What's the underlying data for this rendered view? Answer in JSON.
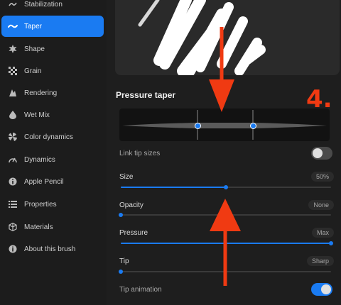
{
  "sidebar": {
    "items": [
      {
        "label": "Stabilization",
        "icon": "stabilization-icon",
        "active": false
      },
      {
        "label": "Taper",
        "icon": "taper-icon",
        "active": true
      },
      {
        "label": "Shape",
        "icon": "shape-icon",
        "active": false
      },
      {
        "label": "Grain",
        "icon": "grain-icon",
        "active": false
      },
      {
        "label": "Rendering",
        "icon": "rendering-icon",
        "active": false
      },
      {
        "label": "Wet Mix",
        "icon": "wet-mix-icon",
        "active": false
      },
      {
        "label": "Color dynamics",
        "icon": "color-dynamics-icon",
        "active": false
      },
      {
        "label": "Dynamics",
        "icon": "dynamics-icon",
        "active": false
      },
      {
        "label": "Apple Pencil",
        "icon": "apple-pencil-icon",
        "active": false
      },
      {
        "label": "Properties",
        "icon": "properties-icon",
        "active": false
      },
      {
        "label": "Materials",
        "icon": "materials-icon",
        "active": false
      },
      {
        "label": "About this brush",
        "icon": "info-icon",
        "active": false
      }
    ]
  },
  "main": {
    "section_title": "Pressure taper",
    "link_tip_sizes": {
      "label": "Link tip sizes",
      "enabled": false
    },
    "sliders": {
      "size": {
        "label": "Size",
        "value_text": "50%",
        "fraction": 0.5
      },
      "opacity": {
        "label": "Opacity",
        "value_text": "None",
        "fraction": 0.0
      },
      "pressure": {
        "label": "Pressure",
        "value_text": "Max",
        "fraction": 1.0
      },
      "tip": {
        "label": "Tip",
        "value_text": "Sharp",
        "fraction": 0.0
      }
    },
    "tip_animation": {
      "label": "Tip animation",
      "enabled": true
    }
  },
  "annotation": {
    "step_label": "4."
  },
  "colors": {
    "accent": "#1a7bf2",
    "annotation": "#f03a12"
  }
}
